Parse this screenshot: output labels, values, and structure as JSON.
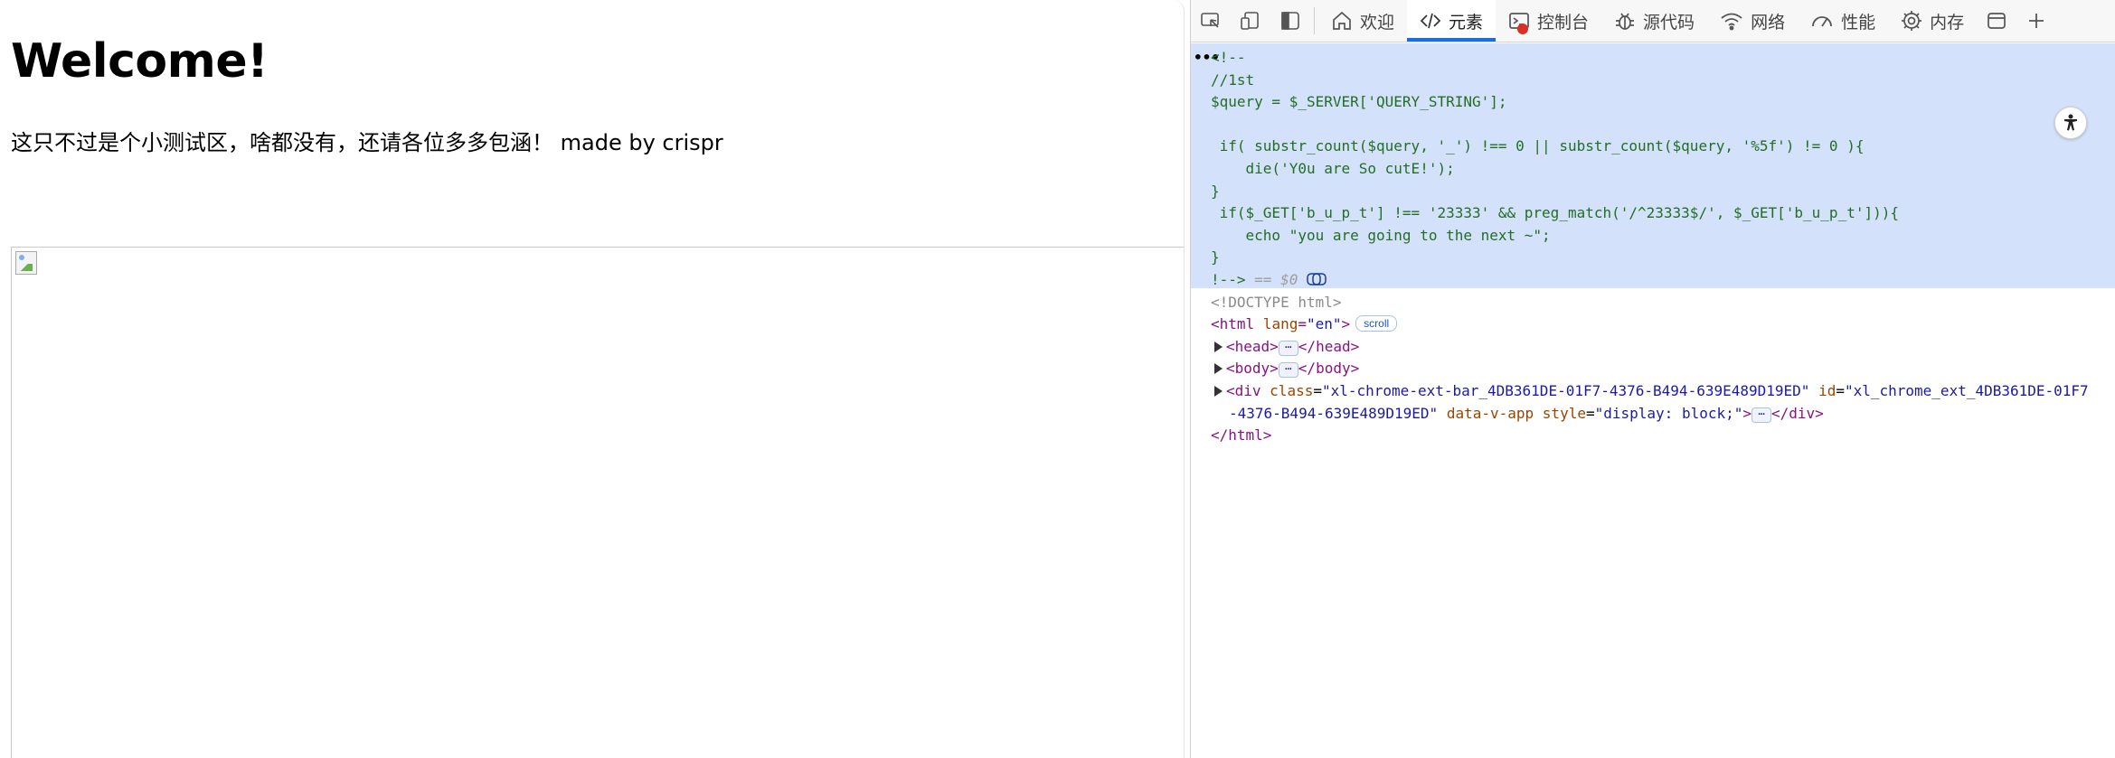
{
  "page": {
    "heading": "Welcome!",
    "text": "这只不过是个小测试区，啥都没有，还请各位多多包涵！ made by crispr"
  },
  "devtools": {
    "tabs": [
      {
        "label": "欢迎",
        "icon": "home-icon"
      },
      {
        "label": "元素",
        "icon": "code-icon"
      },
      {
        "label": "控制台",
        "icon": "console-icon"
      },
      {
        "label": "源代码",
        "icon": "bug-icon"
      },
      {
        "label": "网络",
        "icon": "wifi-icon"
      },
      {
        "label": "性能",
        "icon": "gauge-icon"
      },
      {
        "label": "内存",
        "icon": "gear-icon"
      }
    ],
    "active_tab": "元素",
    "comment_lines": [
      "<!--",
      "//1st",
      "$query = $_SERVER['QUERY_STRING'];",
      "",
      " if( substr_count($query, '_') !== 0 || substr_count($query, '%5f') != 0 ){",
      "    die('Y0u are So cutE!');",
      "}",
      " if($_GET['b_u_p_t'] !== '23333' && preg_match('/^23333$/', $_GET['b_u_p_t'])){",
      "    echo \"you are going to the next ~\";",
      "}"
    ],
    "comment_end": "!-->",
    "selected_marker": "== $0",
    "doctype": "<!DOCTYPE html>",
    "html_open_tag": "<html",
    "html_attr_name": "lang",
    "html_attr_eq": "=",
    "html_attr_value": "\"en\"",
    "html_open_close": ">",
    "scroll_badge": "scroll",
    "head_open": "<head>",
    "head_close": "</head>",
    "body_open": "<body>",
    "body_close": "</body>",
    "div_open": "<div",
    "div_class_attr": "class",
    "div_class_value": "\"xl-chrome-ext-bar_4DB361DE-01F7-4376-B494-639E489D19ED\"",
    "div_id_attr": "id",
    "div_id_value_1": "\"xl_chrome_ext_4DB361DE-01F7",
    "div_id_value_2": "-4376-B494-639E489D19ED\"",
    "div_data_attr": "data-v-app",
    "div_style_attr": "style",
    "div_style_value": "\"display: block;\"",
    "div_open_close": ">",
    "div_close": "</div>",
    "html_close": "</html>",
    "ellipsis": "⋯",
    "dots": "•••"
  }
}
